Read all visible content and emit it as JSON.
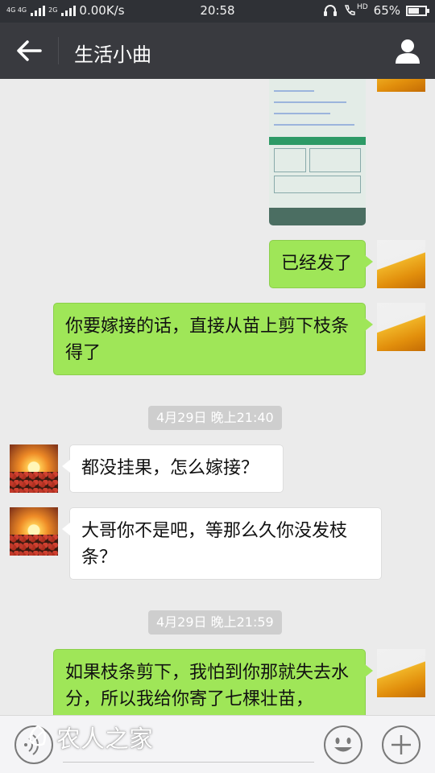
{
  "status_bar": {
    "network": "4G 4G",
    "network2": "2G",
    "speed": "0.00K/s",
    "time": "20:58",
    "hd": "HD",
    "battery": "65%",
    "battery_level": 0.65
  },
  "header": {
    "title": "生活小曲",
    "back_icon": "arrow-left-icon",
    "profile_icon": "person-icon"
  },
  "messages": [
    {
      "type": "image",
      "direction": "out"
    },
    {
      "type": "text",
      "direction": "out",
      "text": "已经发了"
    },
    {
      "type": "text",
      "direction": "out",
      "text": "你要嫁接的话，直接从苗上剪下枝条得了"
    },
    {
      "type": "timestamp",
      "text": "4月29日 晚上21:40"
    },
    {
      "type": "text",
      "direction": "in",
      "text": "都没挂果，怎么嫁接？"
    },
    {
      "type": "text",
      "direction": "in",
      "text": "大哥你不是吧，等那么久你没发枝条？"
    },
    {
      "type": "timestamp",
      "text": "4月29日 晚上21:59"
    },
    {
      "type": "text",
      "direction": "out",
      "text": "如果枝条剪下，我怕到你那就失去水分，所以我给你寄了七棵壮苗，"
    }
  ],
  "input_bar": {
    "placeholder": "",
    "watermark": "农人之家",
    "voice_icon": "voice-icon",
    "emoji_icon": "emoji-icon",
    "plus_icon": "plus-icon"
  },
  "colors": {
    "outgoing_bubble": "#9fe658",
    "incoming_bubble": "#ffffff",
    "header_bg": "#393a3f",
    "chat_bg": "#ebebeb"
  }
}
